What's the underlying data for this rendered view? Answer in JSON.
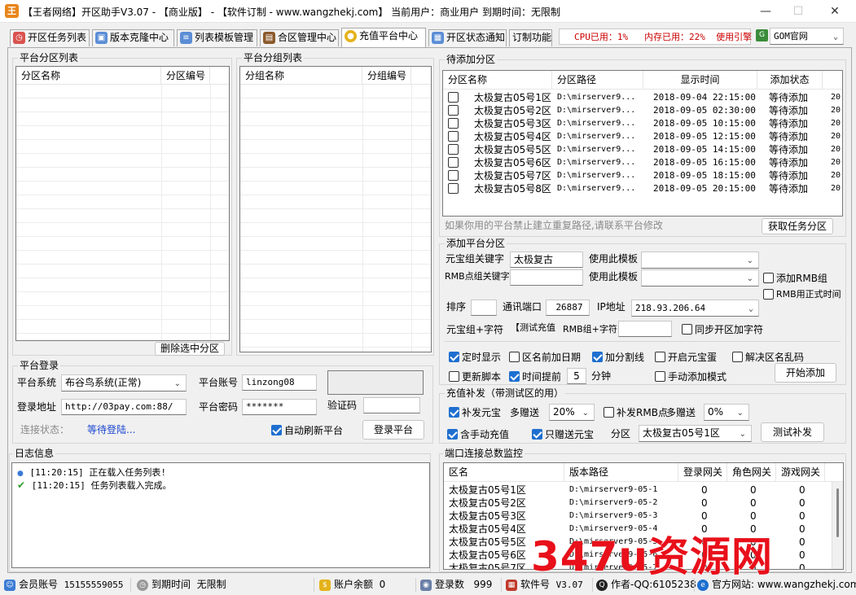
{
  "window": {
    "title": "【王者网络】开区助手V3.07 - 【商业版】 - 【软件订制 - www.wangzhekj.com】 当前用户：商业用户  到期时间：无限制",
    "min": "—",
    "max": "☐",
    "close": "✕"
  },
  "tabs": [
    {
      "label": "开区任务列表",
      "icon": "clock-icon",
      "color": "#d9534f"
    },
    {
      "label": "版本克隆中心",
      "icon": "clone-icon",
      "color": "#5b8dd6"
    },
    {
      "label": "列表模板管理",
      "icon": "list-icon",
      "color": "#5b8dd6"
    },
    {
      "label": "合区管理中心",
      "icon": "merge-icon",
      "color": "#8b5a2b"
    },
    {
      "label": "充值平台中心",
      "icon": "coin-icon",
      "color": "#e4b21a"
    },
    {
      "label": "开区状态通知",
      "icon": "doc-icon",
      "color": "#5b8dd6"
    },
    {
      "label": "订制功能",
      "icon": "",
      "color": ""
    }
  ],
  "sys": {
    "cpu": "CPU已用：1%",
    "mem": "内存已用：22%",
    "engine_label": "使用引擎",
    "engine_value": "GOM官网"
  },
  "platform_zone_list": {
    "title": "平台分区列表",
    "col1": "分区名称",
    "col2": "分区编号",
    "delete_button": "删除选中分区"
  },
  "platform_group_list": {
    "title": "平台分组列表",
    "col1": "分组名称",
    "col2": "分组编号"
  },
  "pending": {
    "title": "待添加分区",
    "headers": [
      "分区名称",
      "分区路径",
      "显示时间",
      "添加状态"
    ],
    "rows": [
      {
        "name": "太极复古05号1区",
        "path": "D:\\mirserver9...",
        "time": "2018-09-04  22:15:00",
        "status": "等待添加",
        "extra": "20"
      },
      {
        "name": "太极复古05号2区",
        "path": "D:\\mirserver9...",
        "time": "2018-09-05  02:30:00",
        "status": "等待添加",
        "extra": "20"
      },
      {
        "name": "太极复古05号3区",
        "path": "D:\\mirserver9...",
        "time": "2018-09-05  10:15:00",
        "status": "等待添加",
        "extra": "20"
      },
      {
        "name": "太极复古05号4区",
        "path": "D:\\mirserver9...",
        "time": "2018-09-05  12:15:00",
        "status": "等待添加",
        "extra": "20"
      },
      {
        "name": "太极复古05号5区",
        "path": "D:\\mirserver9...",
        "time": "2018-09-05  14:15:00",
        "status": "等待添加",
        "extra": "20"
      },
      {
        "name": "太极复古05号6区",
        "path": "D:\\mirserver9...",
        "time": "2018-09-05  16:15:00",
        "status": "等待添加",
        "extra": "20"
      },
      {
        "name": "太极复古05号7区",
        "path": "D:\\mirserver9...",
        "time": "2018-09-05  18:15:00",
        "status": "等待添加",
        "extra": "20"
      },
      {
        "name": "太极复古05号8区",
        "path": "D:\\mirserver9...",
        "time": "2018-09-05  20:15:00",
        "status": "等待添加",
        "extra": "20"
      }
    ],
    "hint": "如果你用的平台禁止建立重复路径,请联系平台修改",
    "fetch_button": "获取任务分区"
  },
  "add_zone": {
    "title": "添加平台分区",
    "yb_keyword_label": "元宝组关键字",
    "yb_keyword_value": "太极复古",
    "template_label1": "使用此模板",
    "rmb_keyword_label": "RMB点组关键字",
    "rmb_keyword_value": "",
    "template_label2": "使用此模板",
    "add_rmb_group": "添加RMB组",
    "rmb_formal_time": "RMB用正式时间",
    "sort_label": "排序",
    "sort_value": "",
    "port_label": "通讯端口",
    "port_value": "26887",
    "ip_label": "IP地址",
    "ip_value": "218.93.206.64",
    "yb_suffix_label": "元宝组+字符",
    "yb_suffix_value": "【测试充值",
    "rmb_suffix_label": "RMB组+字符",
    "rmb_suffix_value": "",
    "sync_suffix": "同步开区加字符",
    "timed_display": "定时显示",
    "prefix_date": "区名前加日期",
    "add_divider": "加分割线",
    "enable_yb_pot": "开启元宝蛋",
    "fix_garbled": "解决区名乱码",
    "update_script": "更新脚本",
    "time_advance": "时间提前",
    "advance_value": "5",
    "minutes": "分钟",
    "manual_mode": "手动添加模式",
    "start_button": "开始添加"
  },
  "recharge": {
    "title": "充值补发（带测试区的用）",
    "reissue_yb": "补发元宝",
    "bonus_label1": "多赠送",
    "bonus_value1": "20%",
    "reissue_rmb": "补发RMB点",
    "bonus_label2": "多赠送",
    "bonus_value2": "0%",
    "include_manual": "含手动充值",
    "only_bonus_yb": "只赠送元宝",
    "zone_label": "分区",
    "zone_value": "太极复古05号1区",
    "test_button": "测试补发"
  },
  "login": {
    "title": "平台登录",
    "system_label": "平台系统",
    "system_value": "布谷鸟系统(正常)",
    "account_label": "平台账号",
    "account_value": "linzong08",
    "url_label": "登录地址",
    "url_value": "http://03pay.com:88/",
    "password_label": "平台密码",
    "password_value": "*******",
    "captcha_label": "验证码",
    "status_label": "连接状态：",
    "status_value": "等待登陆...",
    "auto_refresh": "自动刷新平台",
    "login_button": "登录平台"
  },
  "log": {
    "title": "日志信息",
    "lines": [
      {
        "text": "[11:20:15] 正在载入任务列表!",
        "icon": "info-icon"
      },
      {
        "text": "[11:20:15] 任务列表载入完成。",
        "icon": "check-icon"
      }
    ]
  },
  "ports": {
    "title": "端口连接总数监控",
    "headers": [
      "区名",
      "版本路径",
      "登录网关",
      "角色网关",
      "游戏网关"
    ],
    "rows": [
      {
        "name": "太极复古05号1区",
        "path": "D:\\mirserver9-05-1",
        "a": "0",
        "b": "0",
        "c": "0"
      },
      {
        "name": "太极复古05号2区",
        "path": "D:\\mirserver9-05-2",
        "a": "0",
        "b": "0",
        "c": "0"
      },
      {
        "name": "太极复古05号3区",
        "path": "D:\\mirserver9-05-3",
        "a": "0",
        "b": "0",
        "c": "0"
      },
      {
        "name": "太极复古05号4区",
        "path": "D:\\mirserver9-05-4",
        "a": "0",
        "b": "0",
        "c": "0"
      },
      {
        "name": "太极复古05号5区",
        "path": "D:\\mirserver9-05-5",
        "a": "0",
        "b": "0",
        "c": "0"
      },
      {
        "name": "太极复古05号6区",
        "path": "D:\\mirserver9-05-6",
        "a": "0",
        "b": "0",
        "c": "0"
      },
      {
        "name": "太极复古05号7区",
        "path": "D:\\mirserver9-05-7",
        "a": "0",
        "b": "0",
        "c": "0"
      }
    ]
  },
  "status": {
    "member_label": "会员账号",
    "member_value": "15155559055",
    "expire_label": "到期时间",
    "expire_value": "无限制",
    "balance_label": "账户余额",
    "balance_value": "0",
    "login_count_label": "登录数",
    "login_count_value": "999",
    "version_label": "软件号",
    "version_value": "V3.07",
    "author": "作者-QQ:6105238",
    "site": "官方网站: www.wangzhekj.com"
  },
  "watermark": "347u资源网"
}
